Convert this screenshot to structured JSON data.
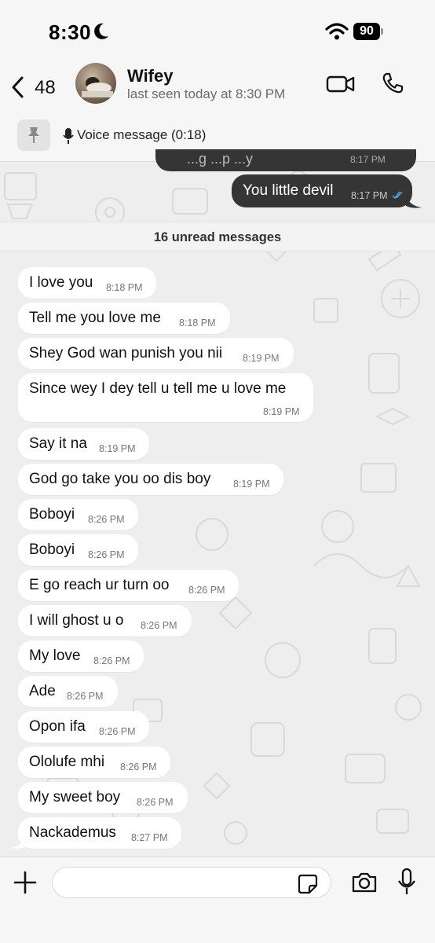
{
  "status_bar": {
    "time": "8:30",
    "battery": "90"
  },
  "header": {
    "back_count": "48",
    "contact_name": "Wifey",
    "last_seen": "last seen today at 8:30 PM"
  },
  "pinned": {
    "text": "Voice message (0:18)"
  },
  "outgoing": {
    "partial_text": "...g  ...p  ...y",
    "partial_time": "8:17 PM",
    "text": "You little devil",
    "time": "8:17 PM"
  },
  "unread_banner": "16 unread messages",
  "messages": [
    {
      "text": "I love you",
      "time": "8:18 PM"
    },
    {
      "text": "Tell me you love me",
      "time": "8:18 PM"
    },
    {
      "text": "Shey God wan punish you nii",
      "time": "8:19 PM"
    },
    {
      "text": "Since wey I dey tell u tell me u love me",
      "time": "8:19 PM"
    },
    {
      "text": "Say it na",
      "time": "8:19 PM"
    },
    {
      "text": "God go take you oo dis boy",
      "time": "8:19 PM"
    },
    {
      "text": "Boboyi",
      "time": "8:26 PM"
    },
    {
      "text": "Boboyi",
      "time": "8:26 PM"
    },
    {
      "text": "E go reach ur turn oo",
      "time": "8:26 PM"
    },
    {
      "text": "I will ghost u o",
      "time": "8:26 PM"
    },
    {
      "text": "My love",
      "time": "8:26 PM"
    },
    {
      "text": "Ade",
      "time": "8:26 PM"
    },
    {
      "text": "Opon ifa",
      "time": "8:26 PM"
    },
    {
      "text": "Ololufe mhi",
      "time": "8:26 PM"
    },
    {
      "text": "My sweet boy",
      "time": "8:26 PM"
    },
    {
      "text": "Nackademus",
      "time": "8:27 PM"
    }
  ],
  "composer": {
    "placeholder": ""
  },
  "colors": {
    "outgoing_bubble": "#353535",
    "incoming_bubble": "#ffffff",
    "read_ticks": "#4fa9e8"
  }
}
